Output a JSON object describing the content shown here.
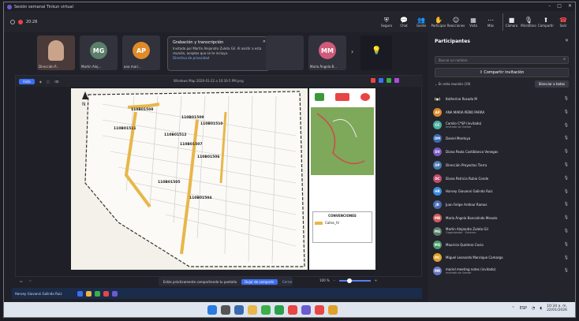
{
  "window": {
    "title": "Sesión semanal Tinkun virtual",
    "rec_time": "20:26"
  },
  "toolbar": {
    "items": [
      {
        "label": "Seguro",
        "icon": "shield-icon",
        "glyph": "⛨"
      },
      {
        "label": "Chat",
        "icon": "chat-icon",
        "glyph": "💬"
      },
      {
        "label": "Gente",
        "icon": "people-icon",
        "glyph": "👥"
      },
      {
        "label": "Participar",
        "icon": "hand-icon",
        "glyph": "✋"
      },
      {
        "label": "Reacciones",
        "icon": "smile-icon",
        "glyph": "☺"
      },
      {
        "label": "Vista",
        "icon": "grid-icon",
        "glyph": "▦"
      },
      {
        "label": "Más",
        "icon": "more-icon",
        "glyph": "⋯"
      }
    ],
    "media": [
      {
        "label": "Cámara",
        "icon": "camera-icon",
        "glyph": "■"
      },
      {
        "label": "Micrófono",
        "icon": "microphone-icon",
        "glyph": "🎙"
      },
      {
        "label": "Compartir",
        "icon": "share-icon",
        "glyph": "⬆"
      },
      {
        "label": "Salir",
        "icon": "phone-icon",
        "glyph": "☎"
      }
    ]
  },
  "gallery": {
    "tiles": [
      {
        "label": "Dirección P...",
        "initials": "",
        "color": "#4a3a3a"
      },
      {
        "label": "Martín Alej...",
        "initials": "MG",
        "color": "#5a7f6a"
      },
      {
        "label": "ana mari...",
        "initials": "AP",
        "color": "#e08a2a"
      },
      {
        "label": "",
        "initials": "",
        "color": "#31323b"
      },
      {
        "label": "María Ángela B...",
        "initials": "MM",
        "color": "#d05a7a"
      }
    ]
  },
  "popup": {
    "title": "Grabación y transcripción",
    "body": "Invitado por Martín Alejandro Zuleta Gil. Al asistir a esta reunión, aceptas que se te incluya.",
    "link": "Directiva de privacidad"
  },
  "share": {
    "view": "Vista",
    "title": "Windows Map 2026-01-22 a 10:30-5 PM.png"
  },
  "map": {
    "labels": [
      "110B01508",
      "110B01509",
      "110B01510",
      "110B01511",
      "110B01512",
      "110B01507",
      "110B01506",
      "110B01505",
      "110B01504"
    ],
    "legend_title": "CONVENCIONES",
    "legend_item": "Calles_IV"
  },
  "banner": {
    "text": "Estás prácticamente compartiendo tu pantalla",
    "button": "Dejar de compartir",
    "close": "Cerrar"
  },
  "zoom": {
    "value": "100 %"
  },
  "inner_taskbar": {
    "text": "Harvey Giovanni Galindo Ruiz"
  },
  "panel": {
    "title": "Participantes",
    "search_placeholder": "Buscar un nombre",
    "invite": "Compartir invitación",
    "in_room": "En esta reunión (19)",
    "mute_all": "Silenciar a todos",
    "people": [
      {
        "initials": "(●)",
        "name": "Katherine Rosado M",
        "sub": "",
        "color": "#222",
        "mic": "🎙"
      },
      {
        "initials": "AP",
        "name": "ANA MARIA PEÑO PARRA",
        "sub": "",
        "color": "#e08a2a",
        "mic": "🎙"
      },
      {
        "initials": "CC",
        "name": "Camilo C*SP (invitado)",
        "sub": "Invitado sin llamar",
        "color": "#4ab0a0",
        "mic": "🎙"
      },
      {
        "initials": "DM",
        "name": "Daniel Montoya",
        "sub": "",
        "color": "#3a6ab0",
        "mic": "🎙"
      },
      {
        "initials": "DV",
        "name": "Diana Paola Castiblanco Venegas",
        "sub": "",
        "color": "#7a5ac0",
        "mic": "🎙"
      },
      {
        "initials": "DP",
        "name": "Dirección Proyectos Tierra",
        "sub": "",
        "color": "#4a7ab0",
        "mic": "🎙"
      },
      {
        "initials": "DC",
        "name": "Diana Patricia Rubio Conde",
        "sub": "",
        "color": "#c04a6a",
        "mic": "🎙"
      },
      {
        "initials": "HR",
        "name": "Harvey Giovanni Galindo Ruiz",
        "sub": "",
        "color": "#3a8ae0",
        "mic": "🎙"
      },
      {
        "initials": "JR",
        "name": "Juan Felipe Ardinar Ramos",
        "sub": "",
        "color": "#4a6ab0",
        "mic": "🎙"
      },
      {
        "initials": "MB",
        "name": "María Ángela Bancalindo Mesuto",
        "sub": "",
        "color": "#d05a5a",
        "mic": "🎙"
      },
      {
        "initials": "MG",
        "name": "Martin Alejandro Zuleta Gil",
        "sub": "Organizador · Externo",
        "color": "#5a7f6a",
        "mic": "🎙"
      },
      {
        "initials": "MQ",
        "name": "Mauricio Quintero Cocio",
        "sub": "",
        "color": "#4a9a6a",
        "mic": "🎙"
      },
      {
        "initials": "MC",
        "name": "Miguel Leonardo Manrique Camargo",
        "sub": "",
        "color": "#e0a02a",
        "mic": "🎙"
      },
      {
        "initials": "MR",
        "name": "mariel meeting notes (invitado)",
        "sub": "Invitado sin llamar",
        "color": "#6a7ac0",
        "mic": "🎙"
      }
    ]
  },
  "win_taskbar": {
    "lang": "ESP",
    "time": "10:34 a. m.",
    "date": "22/01/2026"
  }
}
